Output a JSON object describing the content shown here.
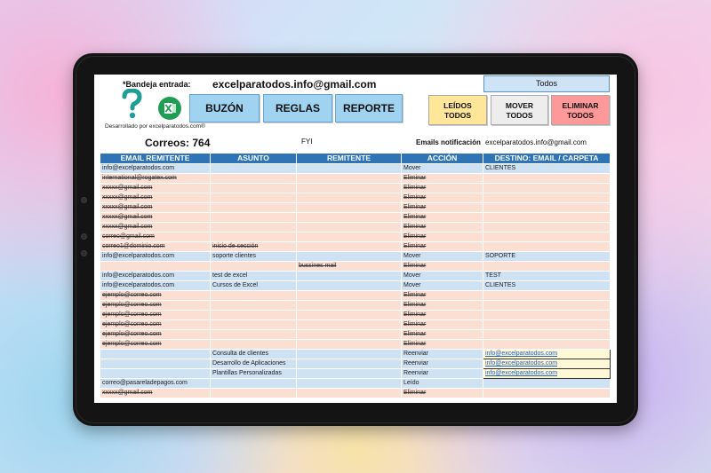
{
  "header": {
    "bandeja_label": "*Bandeja entrada:",
    "inbox_email": "excelparatodos.info@gmail.com",
    "filter_value": "Todos",
    "developer_credit": "Desarrollado por excelparatodos.com®",
    "help_glyph": "?",
    "tabs": [
      "BUZÓN",
      "REGLAS",
      "REPORTE"
    ],
    "actions": {
      "read_all": [
        "LEÍDOS",
        "TODOS"
      ],
      "move_all": [
        "MOVER",
        "TODOS"
      ],
      "delete_all": [
        "ELIMINAR",
        "TODOS"
      ]
    },
    "correos_count": "Correos: 764",
    "fyi": "FYI",
    "notif_label": "Emails notificación",
    "notif_value": "excelparatodos.info@gmail.com"
  },
  "colors": {
    "header_blue": "#2f75b6",
    "row_blue": "#cfe2f3",
    "row_pink": "#fbdfd3",
    "tab_button": "#9fd3f0",
    "read_button": "#ffe699",
    "move_button": "#ededed",
    "delete_button": "#ff9999"
  },
  "icons": {
    "help": "question-mark-icon",
    "excel": "excel-logo-icon"
  },
  "table": {
    "columns": [
      "EMAIL REMITENTE",
      "ASUNTO",
      "REMITENTE",
      "ACCIÓN",
      "DESTINO: EMAIL / CARPETA"
    ],
    "rows": [
      {
        "style": "blue",
        "strike": false,
        "email": "info@excelparatodos.com",
        "asunto": "",
        "remitente": "",
        "accion": "Mover",
        "destino": "CLIENTES",
        "link": false
      },
      {
        "style": "pink",
        "strike": true,
        "email": "international@rogatex.com",
        "asunto": "",
        "remitente": "",
        "accion": "Eliminar",
        "destino": "",
        "link": false
      },
      {
        "style": "pink",
        "strike": true,
        "email": "xxxxx@gmail.com",
        "asunto": "",
        "remitente": "",
        "accion": "Eliminar",
        "destino": "",
        "link": false
      },
      {
        "style": "pink",
        "strike": true,
        "email": "xxxxx@gmail.com",
        "asunto": "",
        "remitente": "",
        "accion": "Eliminar",
        "destino": "",
        "link": false
      },
      {
        "style": "pink",
        "strike": true,
        "email": "xxxxx@gmail.com",
        "asunto": "",
        "remitente": "",
        "accion": "Eliminar",
        "destino": "",
        "link": false
      },
      {
        "style": "pink",
        "strike": true,
        "email": "xxxxx@gmail.com",
        "asunto": "",
        "remitente": "",
        "accion": "Eliminar",
        "destino": "",
        "link": false
      },
      {
        "style": "pink",
        "strike": true,
        "email": "xxxxx@gmail.com",
        "asunto": "",
        "remitente": "",
        "accion": "Eliminar",
        "destino": "",
        "link": false
      },
      {
        "style": "pink",
        "strike": true,
        "email": "correo@gmail.com",
        "asunto": "",
        "remitente": "",
        "accion": "Eliminar",
        "destino": "",
        "link": false
      },
      {
        "style": "pink",
        "strike": true,
        "email": "correo1@dominio.com",
        "asunto": "inicio de sección",
        "remitente": "",
        "accion": "Eliminar",
        "destino": "",
        "link": false
      },
      {
        "style": "blue",
        "strike": false,
        "email": "info@excelparatodos.com",
        "asunto": "soporte clientes",
        "remitente": "",
        "accion": "Mover",
        "destino": "SOPORTE",
        "link": false
      },
      {
        "style": "pink",
        "strike": true,
        "email": "",
        "asunto": "",
        "remitente": "bussines mail",
        "accion": "Eliminar",
        "destino": "",
        "link": false
      },
      {
        "style": "blue",
        "strike": false,
        "email": "info@excelparatodos.com",
        "asunto": "test de excel",
        "remitente": "",
        "accion": "Mover",
        "destino": "TEST",
        "link": false
      },
      {
        "style": "blue",
        "strike": false,
        "email": "info@excelparatodos.com",
        "asunto": "Cursos de Excel",
        "remitente": "",
        "accion": "Mover",
        "destino": "CLIENTES",
        "link": false
      },
      {
        "style": "pink",
        "strike": true,
        "email": "ejemplo@correo.com",
        "asunto": "",
        "remitente": "",
        "accion": "Eliminar",
        "destino": "",
        "link": false
      },
      {
        "style": "pink",
        "strike": true,
        "email": "ejemplo@correo.com",
        "asunto": "",
        "remitente": "",
        "accion": "Eliminar",
        "destino": "",
        "link": false
      },
      {
        "style": "pink",
        "strike": true,
        "email": "ejemplo@correo.com",
        "asunto": "",
        "remitente": "",
        "accion": "Eliminar",
        "destino": "",
        "link": false
      },
      {
        "style": "pink",
        "strike": true,
        "email": "ejemplo@correo.com",
        "asunto": "",
        "remitente": "",
        "accion": "Eliminar",
        "destino": "",
        "link": false
      },
      {
        "style": "pink",
        "strike": true,
        "email": "ejemplo@correo.com",
        "asunto": "",
        "remitente": "",
        "accion": "Eliminar",
        "destino": "",
        "link": false
      },
      {
        "style": "pink",
        "strike": true,
        "email": "ejemplo@correo.com",
        "asunto": "",
        "remitente": "",
        "accion": "Eliminar",
        "destino": "",
        "link": false
      },
      {
        "style": "blue",
        "strike": false,
        "email": "",
        "asunto": "Consulta de clientes",
        "remitente": "",
        "accion": "Reenviar",
        "destino": "info@excelparatodos.com",
        "link": true
      },
      {
        "style": "blue",
        "strike": false,
        "email": "",
        "asunto": "Desarrollo de Aplicaciones",
        "remitente": "",
        "accion": "Reenviar",
        "destino": "info@excelparatodos.com",
        "link": true
      },
      {
        "style": "blue",
        "strike": false,
        "email": "",
        "asunto": "Plantillas Personalizadas",
        "remitente": "",
        "accion": "Reenviar",
        "destino": "info@excelparatodos.com",
        "link": true
      },
      {
        "style": "blue",
        "strike": false,
        "email": "correo@pasareladepagos.com",
        "asunto": "",
        "remitente": "",
        "accion": "Leído",
        "destino": "",
        "link": false
      },
      {
        "style": "pink",
        "strike": true,
        "email": "xxxxx@gmail.com",
        "asunto": "",
        "remitente": "",
        "accion": "Eliminar",
        "destino": "",
        "link": false
      }
    ]
  }
}
